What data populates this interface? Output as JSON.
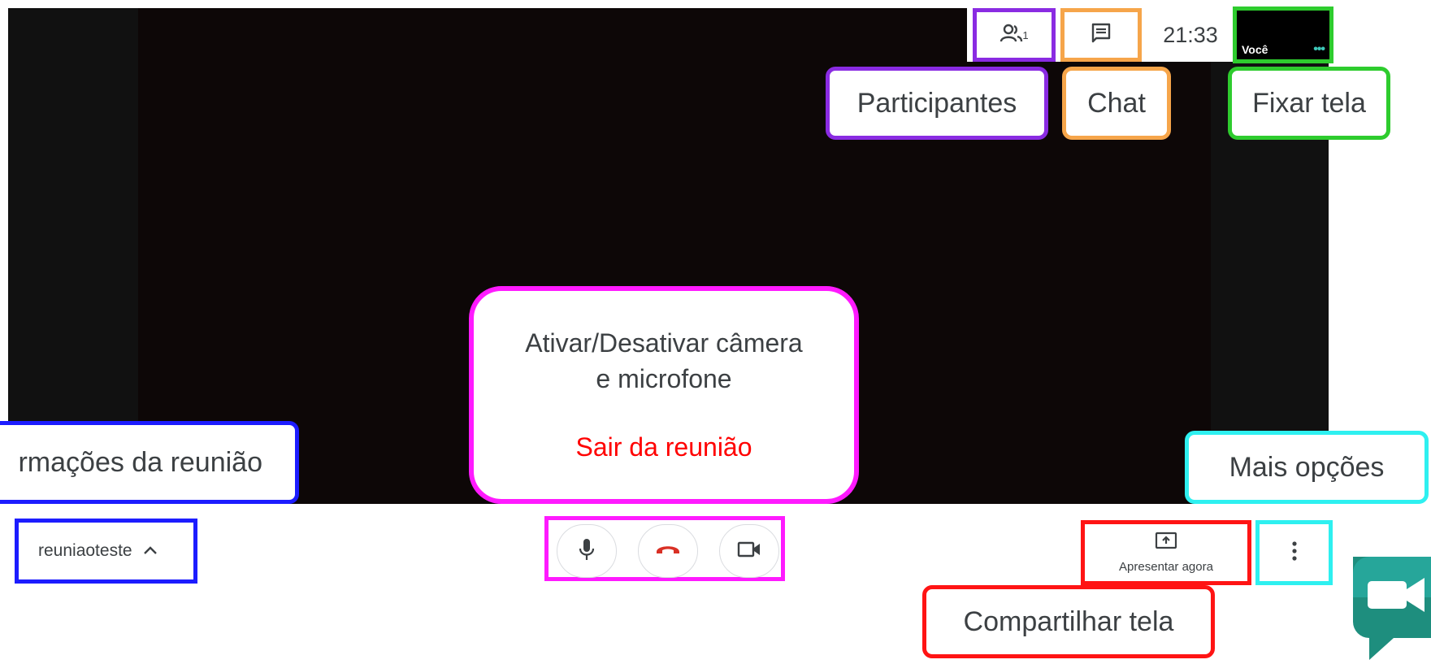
{
  "topbar": {
    "participants_count": "1",
    "clock": "21:33",
    "self_tile_name": "Você"
  },
  "callouts": {
    "participants": "Participantes",
    "chat": "Chat",
    "pin_screen": "Fixar tela",
    "meeting_info": "rmações da reunião",
    "camera_mic_line1": "Ativar/Desativar câmera",
    "camera_mic_line2": "e microfone",
    "leave_meeting": "Sair da reunião",
    "more_options": "Mais opções",
    "share_screen": "Compartilhar tela"
  },
  "bottombar": {
    "meeting_name": "reuniaoteste",
    "present_label": "Apresentar agora"
  },
  "icons": {
    "participants": "people-icon",
    "chat": "chat-icon",
    "expand": "chevron-up-icon",
    "mic": "microphone-icon",
    "hangup": "phone-hangup-icon",
    "camera": "video-camera-icon",
    "present": "present-screen-icon",
    "more": "more-vert-icon",
    "self_menu": "more-horiz-icon",
    "logo": "google-meet-logo"
  },
  "colors": {
    "participants_accent": "#8a2be2",
    "chat_accent": "#f6a54a",
    "pin_accent": "#2ecc2e",
    "info_accent": "#1c1cff",
    "controls_accent": "#ff1aff",
    "more_accent": "#2ef0f0",
    "share_accent": "#ff1414",
    "hangup_red": "#d93025",
    "leave_text": "#ff0000"
  }
}
